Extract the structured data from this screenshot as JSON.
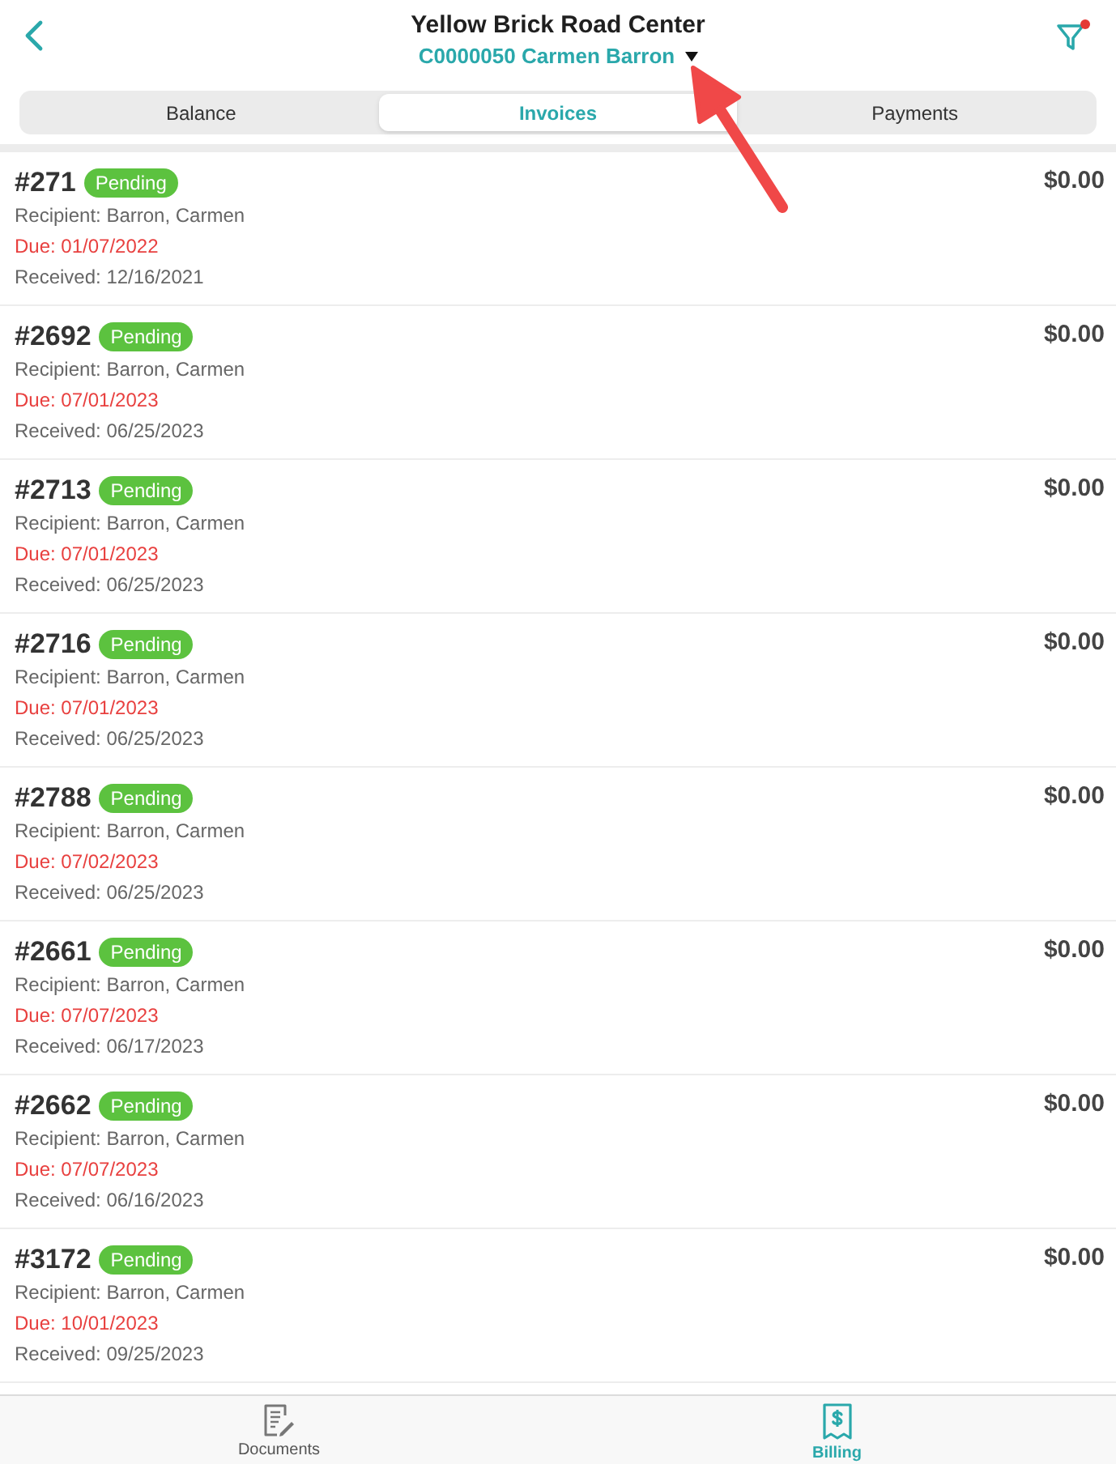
{
  "header": {
    "title": "Yellow Brick Road Center",
    "subtitle": "C0000050 Carmen Barron",
    "filter_active": true
  },
  "tabs": [
    {
      "label": "Balance",
      "selected": false
    },
    {
      "label": "Invoices",
      "selected": true
    },
    {
      "label": "Payments",
      "selected": false
    }
  ],
  "invoices": [
    {
      "number": "#271",
      "status": "Pending",
      "recipient": "Recipient: Barron, Carmen",
      "due": "Due: 01/07/2022",
      "received": "Received: 12/16/2021",
      "amount": "$0.00"
    },
    {
      "number": "#2692",
      "status": "Pending",
      "recipient": "Recipient: Barron, Carmen",
      "due": "Due: 07/01/2023",
      "received": "Received: 06/25/2023",
      "amount": "$0.00"
    },
    {
      "number": "#2713",
      "status": "Pending",
      "recipient": "Recipient: Barron, Carmen",
      "due": "Due: 07/01/2023",
      "received": "Received: 06/25/2023",
      "amount": "$0.00"
    },
    {
      "number": "#2716",
      "status": "Pending",
      "recipient": "Recipient: Barron, Carmen",
      "due": "Due: 07/01/2023",
      "received": "Received: 06/25/2023",
      "amount": "$0.00"
    },
    {
      "number": "#2788",
      "status": "Pending",
      "recipient": "Recipient: Barron, Carmen",
      "due": "Due: 07/02/2023",
      "received": "Received: 06/25/2023",
      "amount": "$0.00"
    },
    {
      "number": "#2661",
      "status": "Pending",
      "recipient": "Recipient: Barron, Carmen",
      "due": "Due: 07/07/2023",
      "received": "Received: 06/17/2023",
      "amount": "$0.00"
    },
    {
      "number": "#2662",
      "status": "Pending",
      "recipient": "Recipient: Barron, Carmen",
      "due": "Due: 07/07/2023",
      "received": "Received: 06/16/2023",
      "amount": "$0.00"
    },
    {
      "number": "#3172",
      "status": "Pending",
      "recipient": "Recipient: Barron, Carmen",
      "due": "Due: 10/01/2023",
      "received": "Received: 09/25/2023",
      "amount": "$0.00"
    }
  ],
  "bottom_tabs": [
    {
      "kind": "documents",
      "label": "Documents",
      "selected": false
    },
    {
      "kind": "billing",
      "label": "Billing",
      "selected": true
    }
  ]
}
